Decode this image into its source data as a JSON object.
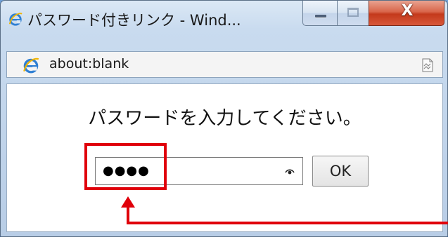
{
  "window": {
    "title": "パスワード付きリンク - Wind...",
    "close_glyph": "X"
  },
  "address_bar": {
    "url": "about:blank",
    "ie_icon": "ie-logo-icon",
    "compat_icon": "compatibility-view-icon"
  },
  "dialog": {
    "prompt": "パスワードを入力してください。",
    "password_value": "●●●●",
    "reveal_icon": "password-reveal-icon",
    "ok_label": "OK"
  },
  "annotation": {
    "highlight_color": "#e0000a"
  }
}
